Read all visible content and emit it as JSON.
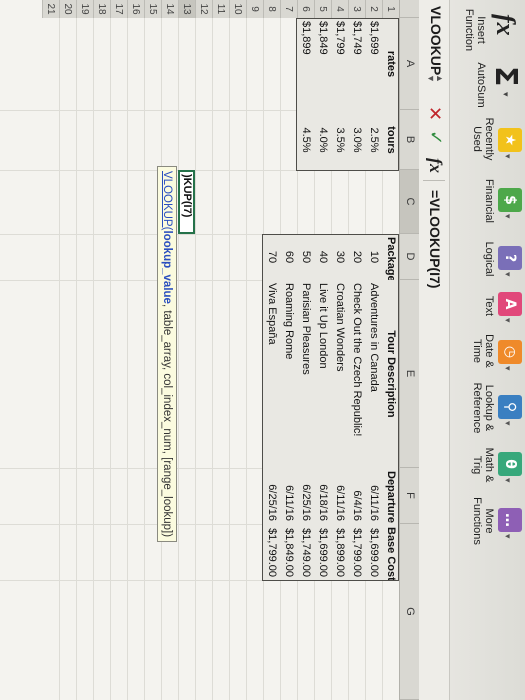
{
  "ribbon": {
    "insert_function": "Insert Function",
    "autosum": "AutoSum",
    "recently_used": "Recently Used",
    "financial": "Financial",
    "logical": "Logical",
    "text": "Text",
    "date_time": "Date & Time",
    "lookup_reference": "Lookup & Reference",
    "math_trig": "Math & Trig",
    "more_functions": "More Functions",
    "fx_glyph": "fx",
    "sigma_glyph": "Σ"
  },
  "formula_bar": {
    "name_box": "VLOOKUP",
    "cancel": "✕",
    "enter": "✓",
    "fx": "fx",
    "formula": "=VLOOKUP(I7)"
  },
  "columns": [
    "A",
    "B",
    "C",
    "D",
    "E",
    "F",
    "G"
  ],
  "rows": [
    "1",
    "2",
    "3",
    "4",
    "5",
    "6",
    "7",
    "8",
    "9",
    "10",
    "11",
    "12",
    "13",
    "14",
    "15",
    "16",
    "17",
    "18",
    "19",
    "20",
    "21"
  ],
  "rates_table": {
    "headers": [
      "rates",
      "tours"
    ],
    "rows": [
      [
        "$1,699",
        "2.5%"
      ],
      [
        "$1,749",
        "3.0%"
      ],
      [
        "$1,799",
        "3.5%"
      ],
      [
        "$1,849",
        "4.0%"
      ],
      [
        "$1,899",
        "4.5%"
      ]
    ]
  },
  "tours_table": {
    "headers": [
      "Package",
      "Tour Description",
      "Departure",
      "Base Cost"
    ],
    "rows": [
      [
        "10",
        "Adventures in Canada",
        "6/11/16",
        "$1,699.00"
      ],
      [
        "20",
        "Check Out the Czech Republic!",
        "6/4/16",
        "$1,799.00"
      ],
      [
        "30",
        "Croatian Wonders",
        "6/11/16",
        "$1,899.00"
      ],
      [
        "40",
        "Live it Up London",
        "6/18/16",
        "$1,699.00"
      ],
      [
        "50",
        "Parisian Pleasures",
        "6/25/16",
        "$1,749.00"
      ],
      [
        "60",
        "Roaming Rome",
        "6/11/16",
        "$1,849.00"
      ],
      [
        "70",
        "Viva España",
        "6/25/16",
        "$1,799.00"
      ]
    ]
  },
  "active_cell": {
    "text": ")KUP(I7)"
  },
  "tooltip": {
    "func": "VLOOKUP(",
    "arg1": "lookup_value",
    "rest": ", table_array, col_index_num, [range_lookup])"
  },
  "colors": {
    "recently_used": "#f2c21b",
    "financial": "#4da84a",
    "logical": "#7a6fb8",
    "text": "#e1487a",
    "date_time": "#ef8a2a",
    "lookup_reference": "#3a7fc1",
    "math_trig": "#37a87b",
    "more_functions": "#8e5fb5",
    "active_border": "#25724a"
  }
}
